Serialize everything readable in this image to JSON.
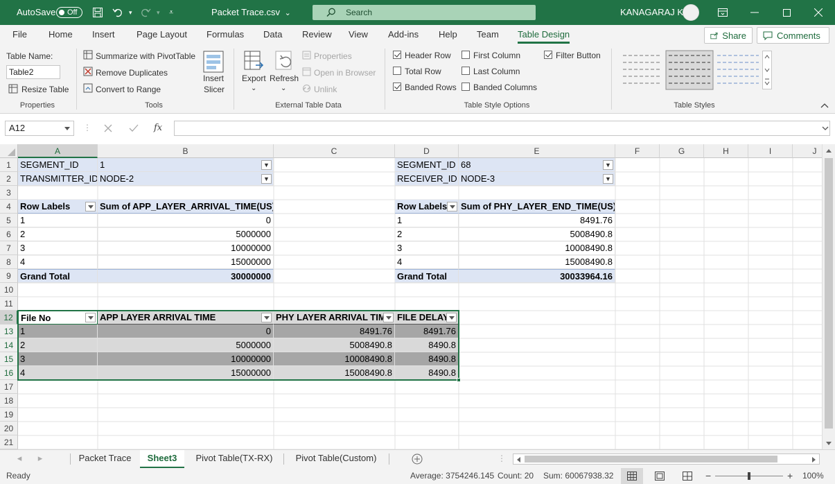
{
  "titlebar": {
    "autosave_label": "AutoSave",
    "autosave_state": "Off",
    "filename": "Packet Trace.csv",
    "filename_chevron": "⌄",
    "search_placeholder": "Search",
    "user": "KANAGARAJ K"
  },
  "ribbon_tabs": [
    "File",
    "Home",
    "Insert",
    "Page Layout",
    "Formulas",
    "Data",
    "Review",
    "View",
    "Add-ins",
    "Help",
    "Team",
    "Table Design"
  ],
  "ribbon_actions": {
    "share": "Share",
    "comments": "Comments"
  },
  "ribbon": {
    "properties": {
      "table_name_label": "Table Name:",
      "table_name_value": "Table2",
      "resize": "Resize Table",
      "group": "Properties"
    },
    "tools": {
      "pivot": "Summarize with PivotTable",
      "remove_dup": "Remove Duplicates",
      "convert": "Convert to Range",
      "insert1": "Insert",
      "insert2": "Slicer",
      "group": "Tools"
    },
    "external": {
      "export": "Export",
      "refresh": "Refresh",
      "properties": "Properties",
      "open_browser": "Open in Browser",
      "unlink": "Unlink",
      "group": "External Table Data"
    },
    "style_options": {
      "items": [
        {
          "label": "Header Row",
          "checked": true
        },
        {
          "label": "Total Row",
          "checked": false
        },
        {
          "label": "Banded Rows",
          "checked": true
        },
        {
          "label": "First Column",
          "checked": false
        },
        {
          "label": "Last Column",
          "checked": false
        },
        {
          "label": "Banded Columns",
          "checked": false
        },
        {
          "label": "Filter Button",
          "checked": true
        }
      ],
      "group": "Table Style Options"
    },
    "styles": {
      "group": "Table Styles"
    }
  },
  "formula_bar": {
    "name_box": "A12",
    "formula": ""
  },
  "columns": [
    "A",
    "B",
    "C",
    "D",
    "E",
    "F",
    "G",
    "H",
    "I",
    "J"
  ],
  "rows": [
    "1",
    "2",
    "3",
    "4",
    "5",
    "6",
    "7",
    "8",
    "9",
    "10",
    "11",
    "12",
    "13",
    "14",
    "15",
    "16",
    "17",
    "18",
    "19",
    "20",
    "21"
  ],
  "pivot_left": {
    "filters": [
      {
        "label": "SEGMENT_ID",
        "value": "1"
      },
      {
        "label": "TRANSMITTER_ID",
        "value": "NODE-2"
      }
    ],
    "header": {
      "row_labels": "Row Labels",
      "value_header": "Sum of APP_LAYER_ARRIVAL_TIME(US)"
    },
    "rows": [
      {
        "label": "1",
        "value": "0"
      },
      {
        "label": "2",
        "value": "5000000"
      },
      {
        "label": "3",
        "value": "10000000"
      },
      {
        "label": "4",
        "value": "15000000"
      }
    ],
    "grand_total": {
      "label": "Grand Total",
      "value": "30000000"
    }
  },
  "pivot_right": {
    "filters": [
      {
        "label": "SEGMENT_ID",
        "value": "68"
      },
      {
        "label": "RECEIVER_ID",
        "value": "NODE-3"
      }
    ],
    "header": {
      "row_labels": "Row Labels",
      "value_header": "Sum of PHY_LAYER_END_TIME(US)"
    },
    "rows": [
      {
        "label": "1",
        "value": "8491.76"
      },
      {
        "label": "2",
        "value": "5008490.8"
      },
      {
        "label": "3",
        "value": "10008490.8"
      },
      {
        "label": "4",
        "value": "15008490.8"
      }
    ],
    "grand_total": {
      "label": "Grand Total",
      "value": "30033964.16"
    }
  },
  "table": {
    "headers": [
      "File No",
      "APP LAYER ARRIVAL TIME",
      "PHY LAYER ARRIVAL TIME",
      "FILE DELAY"
    ],
    "rows": [
      [
        "1",
        "0",
        "8491.76",
        "8491.76"
      ],
      [
        "2",
        "5000000",
        "5008490.8",
        "8490.8"
      ],
      [
        "3",
        "10000000",
        "10008490.8",
        "8490.8"
      ],
      [
        "4",
        "15000000",
        "15008490.8",
        "8490.8"
      ]
    ]
  },
  "sheets": [
    {
      "name": "Packet Trace",
      "active": false
    },
    {
      "name": "Sheet3",
      "active": true
    },
    {
      "name": "Pivot Table(TX-RX)",
      "active": false
    },
    {
      "name": "Pivot Table(Custom)",
      "active": false
    }
  ],
  "status": {
    "ready": "Ready",
    "average": "Average: 3754246.145",
    "count": "Count: 20",
    "sum": "Sum: 60067938.32",
    "zoom": "100%"
  },
  "colors": {
    "accent": "#217346",
    "pivot_band": "#dde5f4",
    "table_band_dark": "#a6a6a6",
    "table_band_light": "#d9d9d9"
  }
}
